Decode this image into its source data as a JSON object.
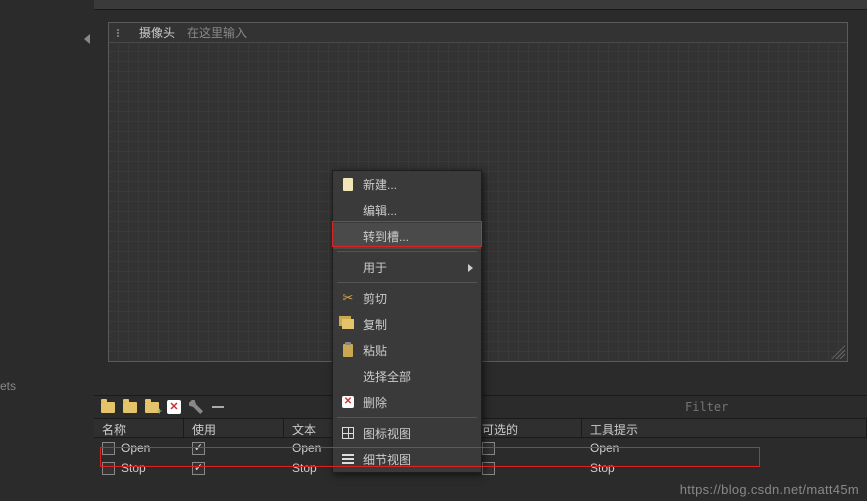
{
  "canvas": {
    "label_widget": "摄像头",
    "placeholder": "在这里输入"
  },
  "context_menu": [
    {
      "icon": "page-icon",
      "label": "新建..."
    },
    {
      "icon": "",
      "label": "编辑..."
    },
    {
      "icon": "",
      "label": "转到槽...",
      "highlight": true
    },
    {
      "sep": true
    },
    {
      "icon": "",
      "label": "用于",
      "submenu": true
    },
    {
      "sep": true
    },
    {
      "icon": "scissors-icon",
      "label": "剪切"
    },
    {
      "icon": "copy-icon",
      "label": "复制"
    },
    {
      "icon": "paste-icon",
      "label": "粘贴"
    },
    {
      "icon": "",
      "label": "选择全部"
    },
    {
      "icon": "delete-icon",
      "label": "删除"
    },
    {
      "sep": true
    },
    {
      "icon": "grid-icon",
      "label": "图标视图"
    },
    {
      "icon": "list-icon",
      "label": "细节视图"
    }
  ],
  "bottom_toolbar": {
    "filter_placeholder": "Filter"
  },
  "table": {
    "headers": {
      "name": "名称",
      "use": "使用",
      "text": "文本",
      "selectable": "可选的",
      "tooltip": "工具提示"
    },
    "rows": [
      {
        "name": "Open",
        "use": true,
        "text": "Open",
        "selectable": false,
        "tooltip": "Open"
      },
      {
        "name": "Stop",
        "use": true,
        "text": "Stop",
        "selectable": false,
        "tooltip": "Stop"
      }
    ]
  },
  "left_panel": {
    "ets_fragment": "ets"
  },
  "watermark": "https://blog.csdn.net/matt45m"
}
